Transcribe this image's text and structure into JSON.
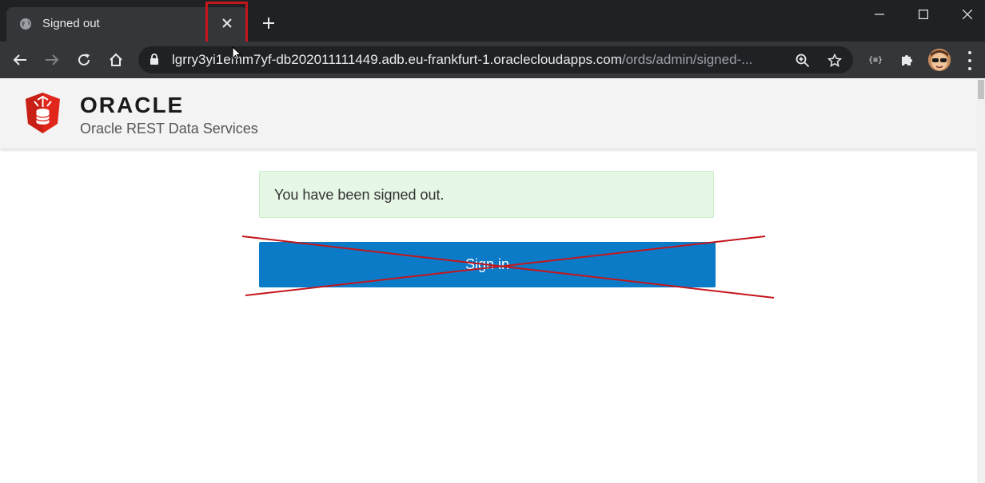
{
  "browser": {
    "tab": {
      "title": "Signed out"
    },
    "url": {
      "domain": "lgrry3yi1emm7yf-db202011111449.adb.eu-frankfurt-1.oraclecloudapps.com",
      "path": "/ords/admin/signed-..."
    }
  },
  "header": {
    "brand_name": "ORACLE",
    "product": "Oracle REST Data Services"
  },
  "main": {
    "alert_message": "You have been signed out.",
    "signin_label": "Sign in"
  },
  "colors": {
    "annotation_red": "#c4161c",
    "signin_blue": "#0b7bc8",
    "alert_green": "#e6f7e6"
  }
}
